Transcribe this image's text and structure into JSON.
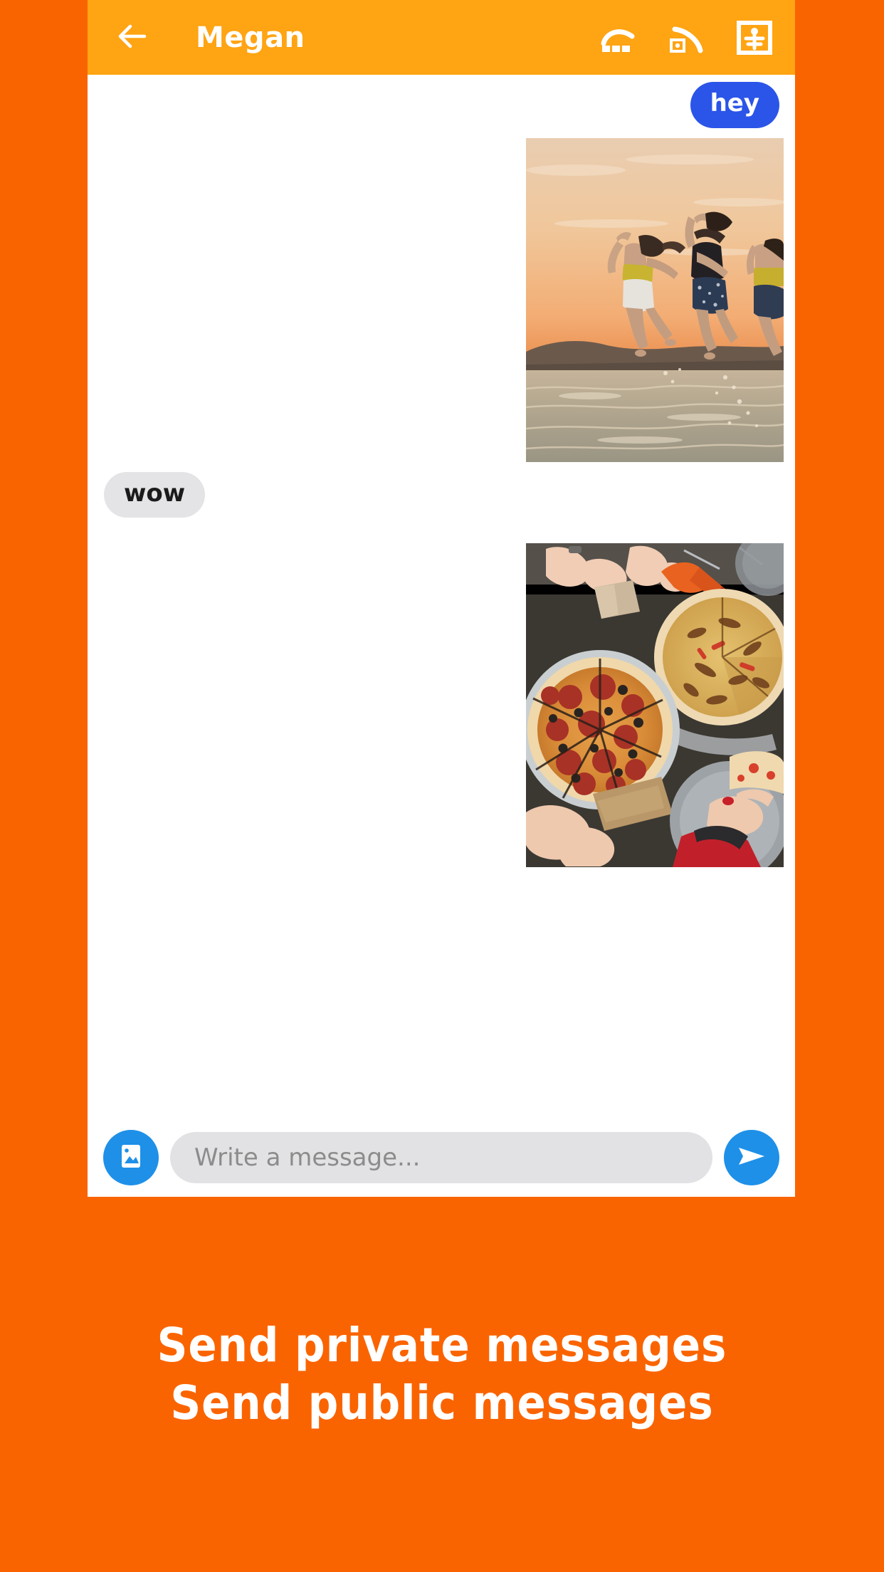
{
  "theme": {
    "page_background": "#FA6400",
    "appbar_background": "#FFA413",
    "outgoing_bubble": "#2B55E8",
    "incoming_bubble": "#E4E4E6",
    "action_blue": "#1E90E8",
    "input_background": "#E2E2E4"
  },
  "appbar": {
    "back_label": "back-arrow",
    "title": "Megan",
    "actions": [
      {
        "name": "signal-bars-icon",
        "label": "Signal"
      },
      {
        "name": "broadcast-icon",
        "label": "Broadcast"
      },
      {
        "name": "profile-card-icon",
        "label": "Profile"
      }
    ]
  },
  "chat": {
    "messages": [
      {
        "type": "text",
        "direction": "out",
        "text": "hey"
      },
      {
        "type": "image",
        "direction": "out",
        "alt": "Three women jumping on a beach at sunset"
      },
      {
        "type": "text",
        "direction": "in",
        "text": "wow"
      },
      {
        "type": "image",
        "direction": "out",
        "alt": "Friends sharing pizzas at a table, overhead view"
      }
    ]
  },
  "composer": {
    "attach_icon": "image-icon",
    "placeholder": "Write a message...",
    "value": "",
    "send_icon": "send-icon"
  },
  "caption": {
    "lines": [
      "Send private messages",
      "Send public messages"
    ]
  }
}
